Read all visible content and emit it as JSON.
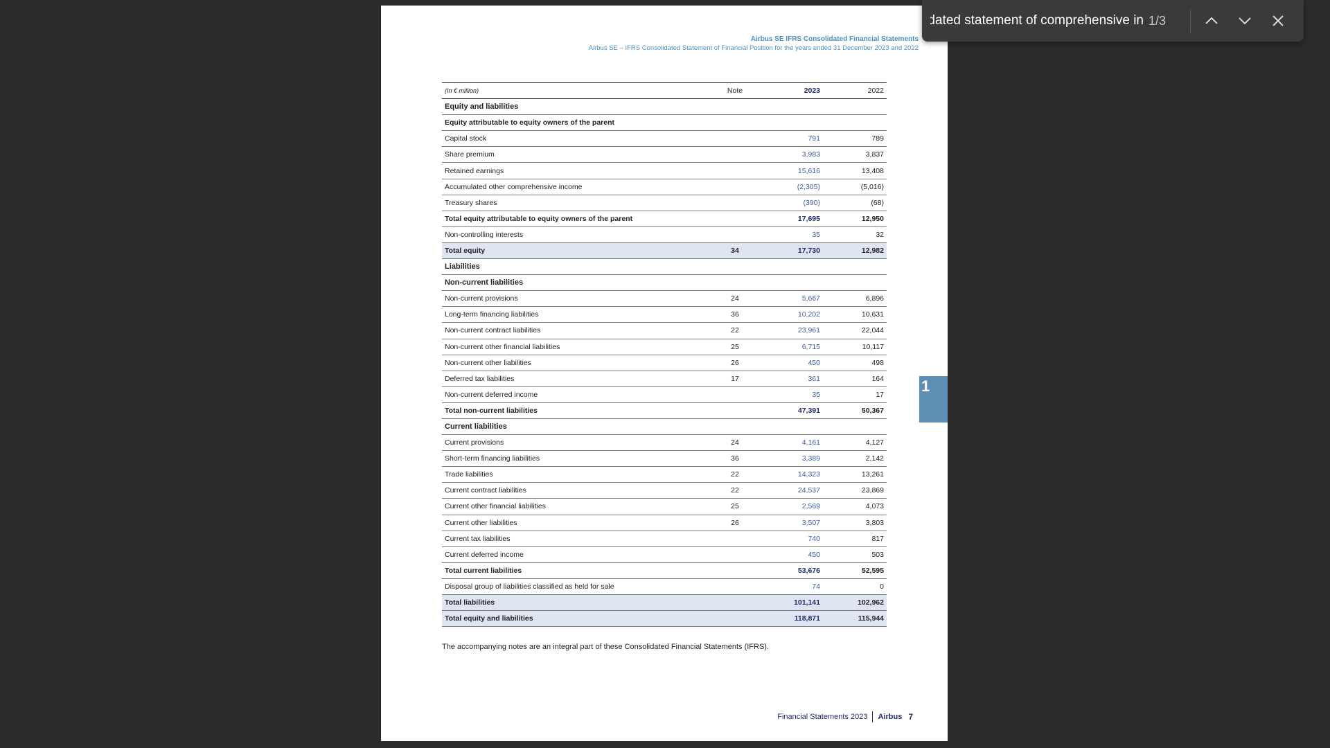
{
  "find_bar": {
    "query": "lidated statement of comprehensive in",
    "match_count": "1/3",
    "icons": [
      "chevron-up-icon",
      "chevron-down-icon",
      "close-icon"
    ]
  },
  "page": {
    "header_title": "Airbus SE IFRS Consolidated Financial Statements",
    "header_subtitle": "Airbus SE – IFRS Consolidated Statement of Financial Position for the years ended 31 December 2023 and 2022",
    "table_header": {
      "label": "(In € million)",
      "note": "Note",
      "year1": "2023",
      "year2": "2022"
    },
    "rows": [
      {
        "label": "Equity and liabilities",
        "note": "",
        "y1": "",
        "y2": "",
        "style": "section"
      },
      {
        "label": "Equity attributable to equity owners of the parent",
        "note": "",
        "y1": "",
        "y2": "",
        "style": "bold"
      },
      {
        "label": "Capital stock",
        "note": "",
        "y1": "791",
        "y2": "789",
        "style": ""
      },
      {
        "label": "Share premium",
        "note": "",
        "y1": "3,983",
        "y2": "3,837",
        "style": ""
      },
      {
        "label": "Retained earnings",
        "note": "",
        "y1": "15,616",
        "y2": "13,408",
        "style": ""
      },
      {
        "label": "Accumulated other comprehensive income",
        "note": "",
        "y1": "(2,305)",
        "y2": "(5,016)",
        "style": ""
      },
      {
        "label": "Treasury shares",
        "note": "",
        "y1": "(390)",
        "y2": "(68)",
        "style": ""
      },
      {
        "label": "Total equity attributable to equity owners of the parent",
        "note": "",
        "y1": "17,695",
        "y2": "12,950",
        "style": "bold"
      },
      {
        "label": "Non-controlling interests",
        "note": "",
        "y1": "35",
        "y2": "32",
        "style": ""
      },
      {
        "label": "Total equity",
        "note": "34",
        "y1": "17,730",
        "y2": "12,982",
        "style": "bold hl"
      },
      {
        "label": "Liabilities",
        "note": "",
        "y1": "",
        "y2": "",
        "style": "section"
      },
      {
        "label": "Non-current liabilities",
        "note": "",
        "y1": "",
        "y2": "",
        "style": "section"
      },
      {
        "label": "Non-current provisions",
        "note": "24",
        "y1": "5,667",
        "y2": "6,896",
        "style": ""
      },
      {
        "label": "Long-term financing liabilities",
        "note": "36",
        "y1": "10,202",
        "y2": "10,631",
        "style": ""
      },
      {
        "label": "Non-current contract liabilities",
        "note": "22",
        "y1": "23,961",
        "y2": "22,044",
        "style": ""
      },
      {
        "label": "Non-current other financial liabilities",
        "note": "25",
        "y1": "6,715",
        "y2": "10,117",
        "style": ""
      },
      {
        "label": "Non-current other liabilities",
        "note": "26",
        "y1": "450",
        "y2": "498",
        "style": ""
      },
      {
        "label": "Deferred tax liabilities",
        "note": "17",
        "y1": "361",
        "y2": "164",
        "style": ""
      },
      {
        "label": "Non-current deferred income",
        "note": "",
        "y1": "35",
        "y2": "17",
        "style": ""
      },
      {
        "label": "Total non-current liabilities",
        "note": "",
        "y1": "47,391",
        "y2": "50,367",
        "style": "bold"
      },
      {
        "label": "Current liabilities",
        "note": "",
        "y1": "",
        "y2": "",
        "style": "section"
      },
      {
        "label": "Current provisions",
        "note": "24",
        "y1": "4,161",
        "y2": "4,127",
        "style": ""
      },
      {
        "label": "Short-term financing liabilities",
        "note": "36",
        "y1": "3,389",
        "y2": "2,142",
        "style": ""
      },
      {
        "label": "Trade liabilities",
        "note": "22",
        "y1": "14,323",
        "y2": "13,261",
        "style": ""
      },
      {
        "label": "Current contract liabilities",
        "note": "22",
        "y1": "24,537",
        "y2": "23,869",
        "style": ""
      },
      {
        "label": "Current other financial liabilities",
        "note": "25",
        "y1": "2,569",
        "y2": "4,073",
        "style": ""
      },
      {
        "label": "Current other liabilities",
        "note": "26",
        "y1": "3,507",
        "y2": "3,803",
        "style": ""
      },
      {
        "label": "Current tax liabilities",
        "note": "",
        "y1": "740",
        "y2": "817",
        "style": ""
      },
      {
        "label": "Current deferred income",
        "note": "",
        "y1": "450",
        "y2": "503",
        "style": ""
      },
      {
        "label": "Total current liabilities",
        "note": "",
        "y1": "53,676",
        "y2": "52,595",
        "style": "bold"
      },
      {
        "label": "Disposal group of liabilities classified as held for sale",
        "note": "",
        "y1": "74",
        "y2": "0",
        "style": ""
      },
      {
        "label": "Total liabilities",
        "note": "",
        "y1": "101,141",
        "y2": "102,962",
        "style": "bold hl"
      },
      {
        "label": "Total equity and liabilities",
        "note": "",
        "y1": "118,871",
        "y2": "115,944",
        "style": "bold hl"
      }
    ],
    "footnote": "The accompanying notes are an integral part of these Consolidated Financial Statements (IFRS).",
    "footer": {
      "doc": "Financial Statements 2023",
      "brand": "Airbus",
      "page_number": "7"
    },
    "chapter_marker": "1"
  },
  "colors": {
    "background": "#2b2b2b",
    "accent": "#4a90c2",
    "navy": "#1f2a6b",
    "highlight_row": "#dfe4f2",
    "tab": "#5d8fb5"
  }
}
